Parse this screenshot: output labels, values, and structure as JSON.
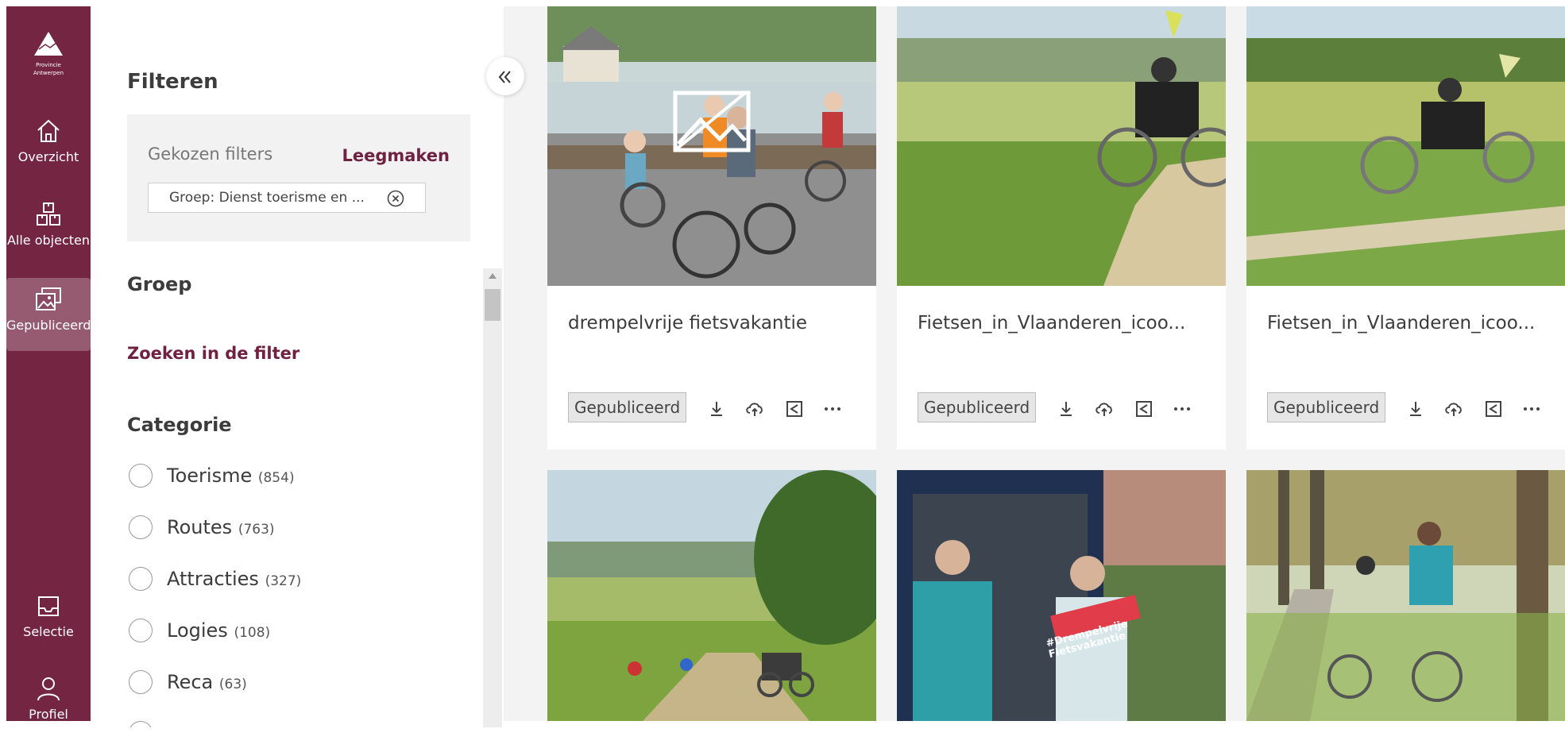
{
  "nav": {
    "logo_lines": [
      "Provincie",
      "Antwerpen"
    ],
    "items": [
      {
        "label": "Overzicht",
        "icon": "home-icon"
      },
      {
        "label": "Alle objecten",
        "icon": "boxes-icon"
      },
      {
        "label": "Gepubliceerd",
        "icon": "published-images-icon",
        "active": true
      },
      {
        "label": "Selectie",
        "icon": "inbox-icon"
      },
      {
        "label": "Profiel",
        "icon": "user-icon"
      }
    ]
  },
  "filters": {
    "title": "Filteren",
    "chosen_label": "Gekozen filters",
    "clear_label": "Leegmaken",
    "chip": "Groep: Dienst toerisme en ...",
    "group_title": "Groep",
    "search_in_filter": "Zoeken in de filter",
    "category_title": "Categorie",
    "categories": [
      {
        "label": "Toerisme",
        "count": "(854)"
      },
      {
        "label": "Routes",
        "count": "(763)"
      },
      {
        "label": "Attracties",
        "count": "(327)"
      },
      {
        "label": "Logies",
        "count": "(108)"
      },
      {
        "label": "Reca",
        "count": "(63)"
      }
    ]
  },
  "cards": [
    {
      "title": "drempelvrije fietsvakantie",
      "status": "Gepubliceerd",
      "placeholder": true
    },
    {
      "title": "Fietsen_in_Vlaanderen_icoo...",
      "status": "Gepubliceerd"
    },
    {
      "title": "Fietsen_in_Vlaanderen_icoo...",
      "status": "Gepubliceerd"
    },
    {
      "title": "",
      "status": ""
    },
    {
      "title": "",
      "status": "",
      "sign_text": "#Drempelvrije Fietsvakantie"
    },
    {
      "title": "",
      "status": ""
    }
  ],
  "colors": {
    "brand": "#732542",
    "link": "#6f2240",
    "panel_bg": "#f2f2f2",
    "content_bg": "#f3f3f3"
  }
}
